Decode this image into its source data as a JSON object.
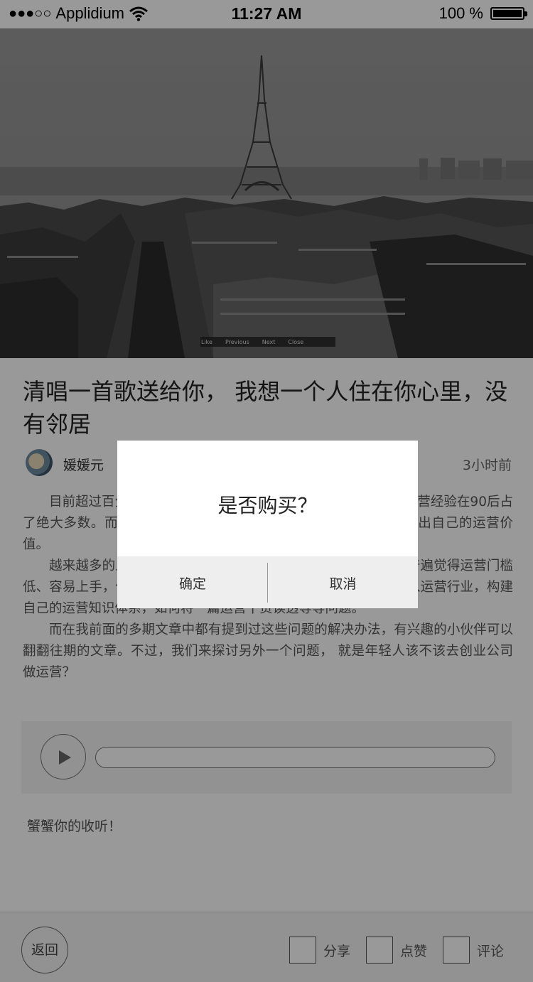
{
  "status_bar": {
    "signal": "●●●○○",
    "carrier": "Applidium",
    "time": "11:27 AM",
    "battery_text": "100 %",
    "battery_level": 1.0
  },
  "hero": {
    "icon": "eiffel-tower-cityscape-photo",
    "caption": [
      "Like",
      "Previous",
      "Next",
      "Close"
    ]
  },
  "article": {
    "title": "清唱一首歌送给你，  我想一个人住在你心里，没有邻居",
    "author": "媛媛元",
    "time": "3小时前",
    "paragraphs": [
      "目前超过百分之八十的运营从业者的工作经验在三年以内，而运营经验在90后占了绝大多数。而这些运营新人做的事情都很杂，什么都做，体现不出自己的运营价值。",
      "越来越多的人都想进入运营行业，以应届生和在校学生为主，普遍觉得运营门槛低、容易上手，但其实不然，大多数人都会问到，如何才能快速进入运营行业，构建自己的运营知识体系，如何将一篇运营干货读透等等问题。",
      "而在我前面的多期文章中都有提到过这些问题的解决办法，有兴趣的小伙伴可以翻翻往期的文章。不过，我们来探讨另外一个问题，  就是年轻人该不该去创业公司做运营？"
    ]
  },
  "audio": {
    "play_icon": "play-icon",
    "progress": 0
  },
  "thanks_text": "蟹蟹你的收听！",
  "bottom_bar": {
    "back_label": "返回",
    "share_label": "分享",
    "like_label": "点赞",
    "comment_label": "评论"
  },
  "dialog": {
    "message": "是否购买？",
    "confirm_label": "确定",
    "cancel_label": "取消"
  }
}
